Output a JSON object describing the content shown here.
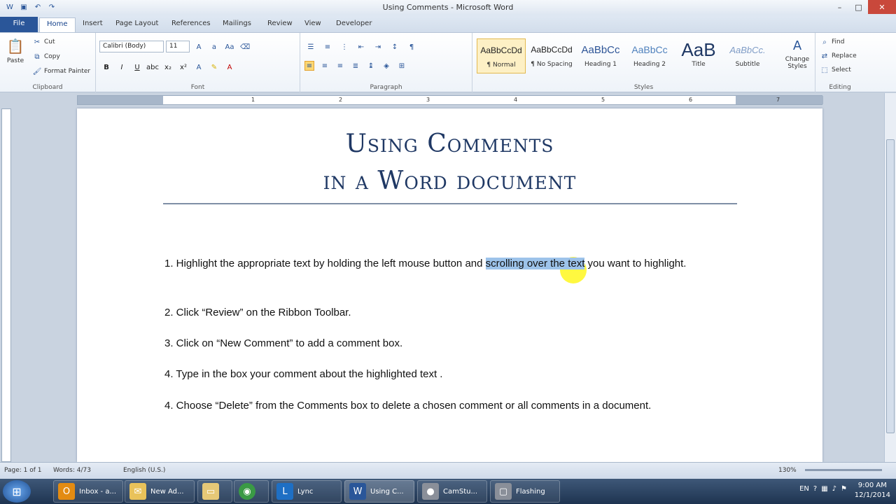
{
  "window": {
    "title": "Using Comments - Microsoft Word"
  },
  "tabs": [
    "File",
    "Home",
    "Insert",
    "Page Layout",
    "References",
    "Mailings",
    "Review",
    "View",
    "Developer"
  ],
  "clipboard": {
    "paste": "Paste",
    "cut": "Cut",
    "copy": "Copy",
    "format_painter": "Format Painter",
    "label": "Clipboard"
  },
  "font": {
    "name": "Calibri (Body)",
    "size": "11",
    "label": "Font"
  },
  "paragraph": {
    "label": "Paragraph"
  },
  "styles": {
    "items": [
      {
        "preview": "AaBbCcDd",
        "name": "¶ Normal"
      },
      {
        "preview": "AaBbCcDd",
        "name": "¶ No Spacing"
      },
      {
        "preview": "AaBbCc",
        "name": "Heading 1"
      },
      {
        "preview": "AaBbCc",
        "name": "Heading 2"
      },
      {
        "preview": "AaB",
        "name": "Title"
      },
      {
        "preview": "AaBbCc.",
        "name": "Subtitle"
      }
    ],
    "change": "Change Styles",
    "label": "Styles"
  },
  "editing": {
    "find": "Find",
    "replace": "Replace",
    "select": "Select",
    "label": "Editing"
  },
  "ruler": {
    "ticks": [
      "1",
      "2",
      "3",
      "4",
      "5",
      "6",
      "7"
    ]
  },
  "document": {
    "title_line1": "Using Comments",
    "title_line2": "in a Word document",
    "p1_before": "1. Highlight the appropriate text by holding the left mouse button and ",
    "p1_highlight": "scrolling over the text",
    "p1_after": " you want to highlight.",
    "p2": "2. Click “Review” on the Ribbon Toolbar.",
    "p3": "3. Click on “New Comment” to add a comment box.",
    "p4": "4. Type in the box your comment about the highlighted text .",
    "p5": "4. Choose “Delete” from the Comments box to delete a chosen comment or all comments in a document."
  },
  "status": {
    "page": "Page: 1 of 1",
    "words": "Words: 4/73",
    "language": "English (U.S.)",
    "zoom": "130%"
  },
  "taskbar": {
    "items": [
      {
        "icon": "outlook-icon",
        "label": "Inbox - a..."
      },
      {
        "icon": "mail-icon",
        "label": "New Ad..."
      },
      {
        "icon": "folder-icon",
        "label": ""
      },
      {
        "icon": "chrome-icon",
        "label": ""
      },
      {
        "icon": "lync-icon",
        "label": "Lync"
      },
      {
        "icon": "word-icon",
        "label": "Using C..."
      },
      {
        "icon": "camstudio-icon",
        "label": "CamStu..."
      },
      {
        "icon": "flash-icon",
        "label": "Flashing"
      }
    ],
    "lang": "EN",
    "time": "9:00 AM",
    "date": "12/1/2014"
  },
  "colors": {
    "accent": "#2a5699",
    "heading": "#1f3864",
    "highlight": "#9dc3ea"
  }
}
